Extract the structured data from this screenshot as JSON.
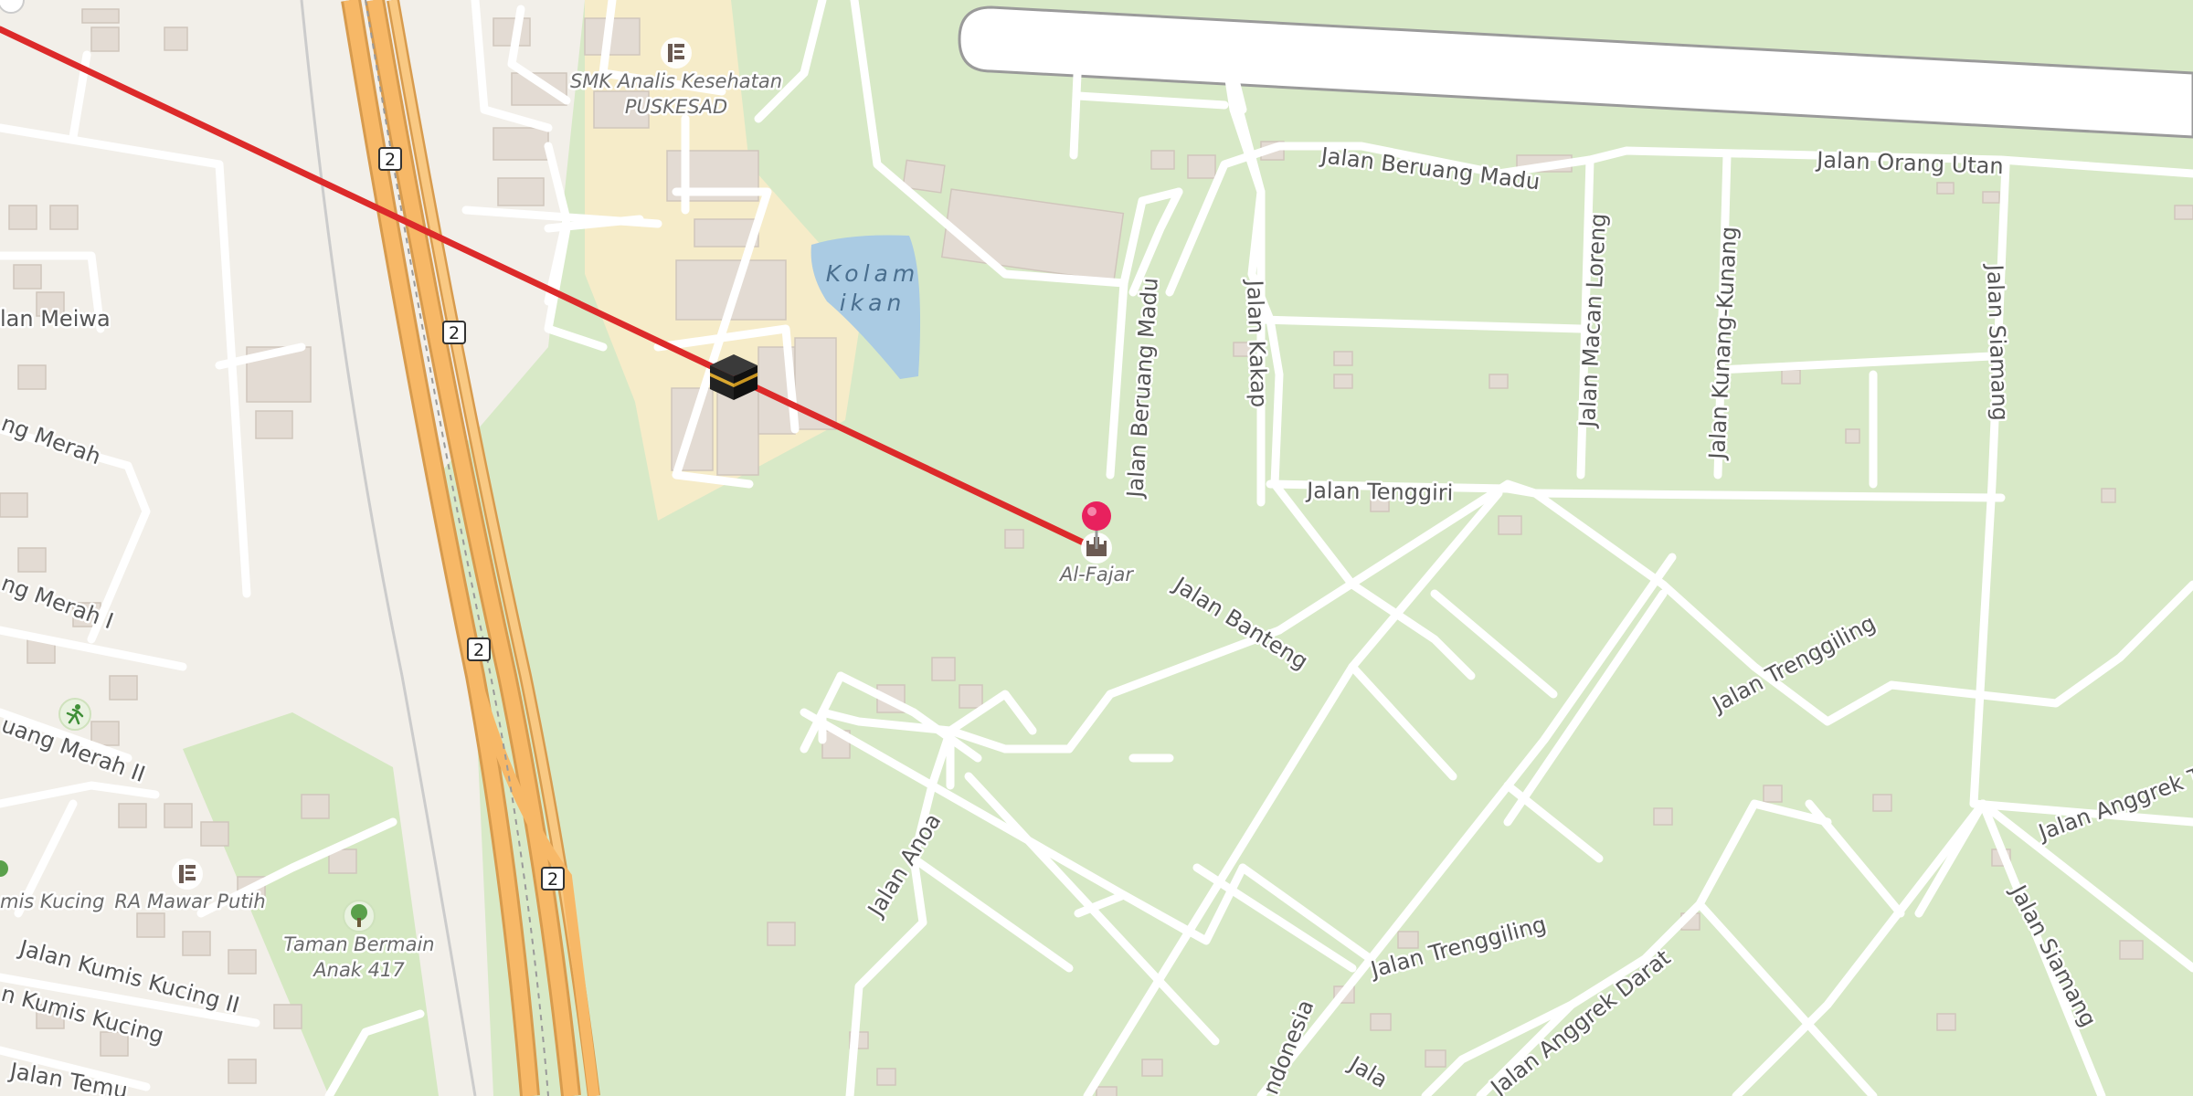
{
  "map": {
    "streets": [
      {
        "id": "beruang-madu-e",
        "text": "Jalan Beruang Madu"
      },
      {
        "id": "orang-utan",
        "text": "Jalan Orang Utan"
      },
      {
        "id": "beruang-madu-n",
        "text": "Jalan Beruang Madu"
      },
      {
        "id": "kakap",
        "text": "Jalan Kakap"
      },
      {
        "id": "macan-loreng",
        "text": "Jalan Macan Loreng"
      },
      {
        "id": "kunang",
        "text": "Jalan Kunang-Kunang"
      },
      {
        "id": "siamang-1",
        "text": "Jalan Siamang"
      },
      {
        "id": "tenggiri",
        "text": "Jalan Tenggiri"
      },
      {
        "id": "banteng",
        "text": "Jalan Banteng"
      },
      {
        "id": "trenggiling-1",
        "text": "Jalan Trenggiling"
      },
      {
        "id": "trenggiling-2",
        "text": "Jalan Trenggiling"
      },
      {
        "id": "anggrek-tan",
        "text": "Jalan Anggrek Tan"
      },
      {
        "id": "siamang-2",
        "text": "Jalan Siamang"
      },
      {
        "id": "anoa",
        "text": "Jalan Anoa"
      },
      {
        "id": "anggrek-darat",
        "text": "Jalan Anggrek Darat"
      },
      {
        "id": "ndonesia",
        "text": "ndonesia"
      },
      {
        "id": "jala",
        "text": "Jala"
      },
      {
        "id": "meiwa",
        "text": "lan Meiwa"
      },
      {
        "id": "g-merah",
        "text": "ng Merah"
      },
      {
        "id": "g-merah-1",
        "text": "ng Merah I"
      },
      {
        "id": "uang-merah-2",
        "text": "uang Merah II"
      },
      {
        "id": "kumis-kucing-2",
        "text": "Jalan Kumis Kucing II"
      },
      {
        "id": "kumis-kucing",
        "text": "n Kumis Kucing"
      },
      {
        "id": "temu",
        "text": "Jalan Temu"
      }
    ],
    "pois": {
      "smk": [
        "SMK Analis Kesehatan",
        "PUSKESAD"
      ],
      "al_fajar": "Al-Fajar",
      "ra_mawar": "RA Mawar Putih",
      "mis_kucing": "mis Kucing",
      "taman": [
        "Taman Bermain",
        "Anak 417"
      ]
    },
    "water": [
      "Kolam",
      "ikan"
    ],
    "route_shields": [
      "2",
      "2",
      "2",
      "2"
    ],
    "icons": {
      "marker": "red-pin-marker",
      "destination": "kaaba-icon",
      "mosque": "mosque-icon",
      "school": "school-icon",
      "sports": "running-icon",
      "park": "tree-icon"
    },
    "colors": {
      "route_line": "#dc2a2a",
      "motorway": "#f7b867",
      "grass": "#d7e8c5",
      "water": "#aacbe3",
      "marker": "#e8215e"
    }
  }
}
